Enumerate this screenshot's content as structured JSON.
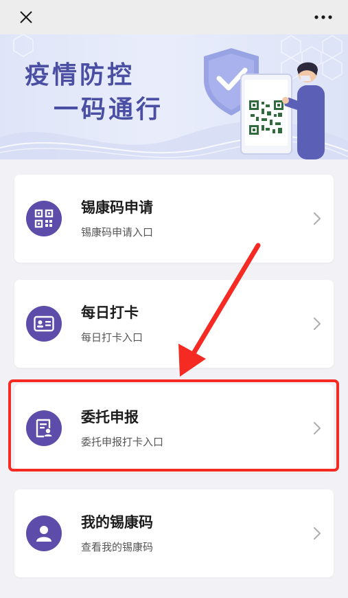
{
  "header": {
    "close_icon": "close-icon",
    "more_icon": "more-dots-icon",
    "bg_color": "#ededed"
  },
  "banner": {
    "title_line1": "疫情防控",
    "title_line2": "一码通行",
    "title_color": "#4b4fa3"
  },
  "menu": {
    "items": [
      {
        "title": "锡康码申请",
        "subtitle": "锡康码申请入口",
        "icon": "qr-code-icon"
      },
      {
        "title": "每日打卡",
        "subtitle": "每日打卡入口",
        "icon": "id-card-icon"
      },
      {
        "title": "委托申报",
        "subtitle": "委托申报打卡入口",
        "icon": "proxy-report-icon"
      },
      {
        "title": "我的锡康码",
        "subtitle": "查看我的锡康码",
        "icon": "user-icon"
      }
    ],
    "icon_color": "#5d4ca9",
    "highlighted_index": 2,
    "highlight_color": "#f52a22"
  }
}
